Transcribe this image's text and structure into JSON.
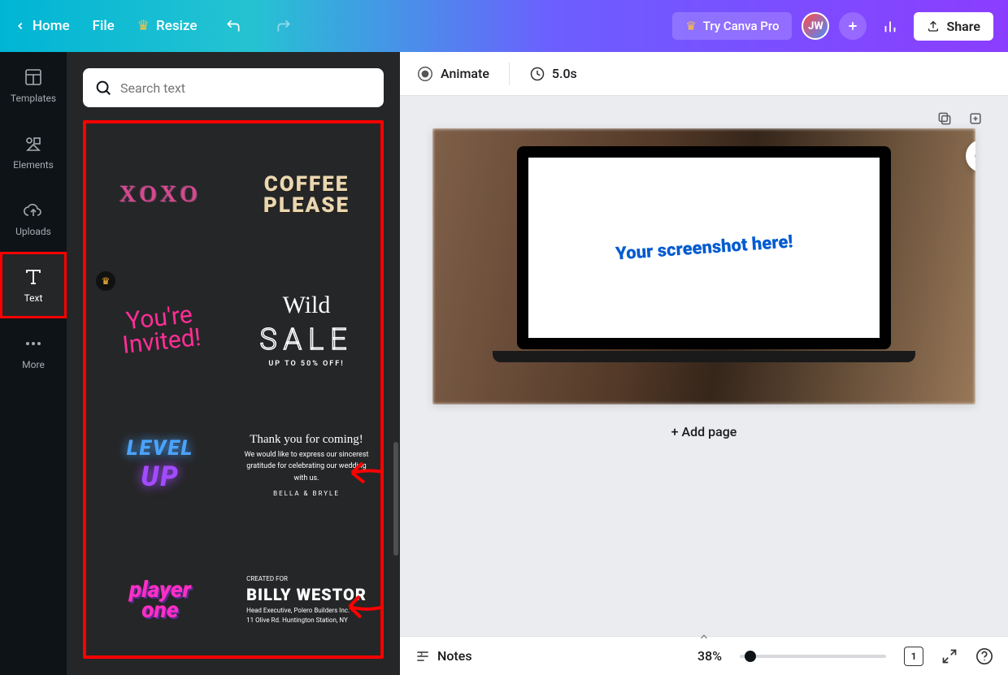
{
  "topbar": {
    "home": "Home",
    "file": "File",
    "resize": "Resize",
    "try_pro": "Try Canva Pro",
    "share": "Share",
    "avatar": "JW"
  },
  "nav": {
    "templates": "Templates",
    "elements": "Elements",
    "uploads": "Uploads",
    "text": "Text",
    "more": "More"
  },
  "search": {
    "placeholder": "Search text"
  },
  "tiles": {
    "xoxo": "XOXO",
    "coffee_l1": "COFFEE",
    "coffee_l2": "PLEASE",
    "invited_l1": "You're",
    "invited_l2": "Invited!",
    "wild": "Wild",
    "sale": "SALE",
    "sale_off": "UP TO 50% OFF!",
    "level": "LEVEL",
    "up": "UP",
    "thank_script": "Thank you for coming!",
    "thank_body": "We would like to express our sincerest gratitude for celebrating our wedding with us.",
    "thank_names": "BELLA & BRYLE",
    "player_l1": "player",
    "player_l2": "one",
    "billy_created": "CREATED FOR",
    "billy_name": "BILLY WESTOR",
    "billy_line1": "Head Executive, Polero Builders Inc.",
    "billy_line2": "11 Olive Rd. Huntington Station, NY"
  },
  "etoolbar": {
    "animate": "Animate",
    "duration": "5.0s"
  },
  "canvas": {
    "screenshot_text": "Your screenshot here!",
    "add_page": "+ Add page"
  },
  "status": {
    "notes": "Notes",
    "zoom": "38%",
    "page_count": "1"
  },
  "colors": {
    "accent": "#8b3dff",
    "highlight": "#ff0000"
  }
}
